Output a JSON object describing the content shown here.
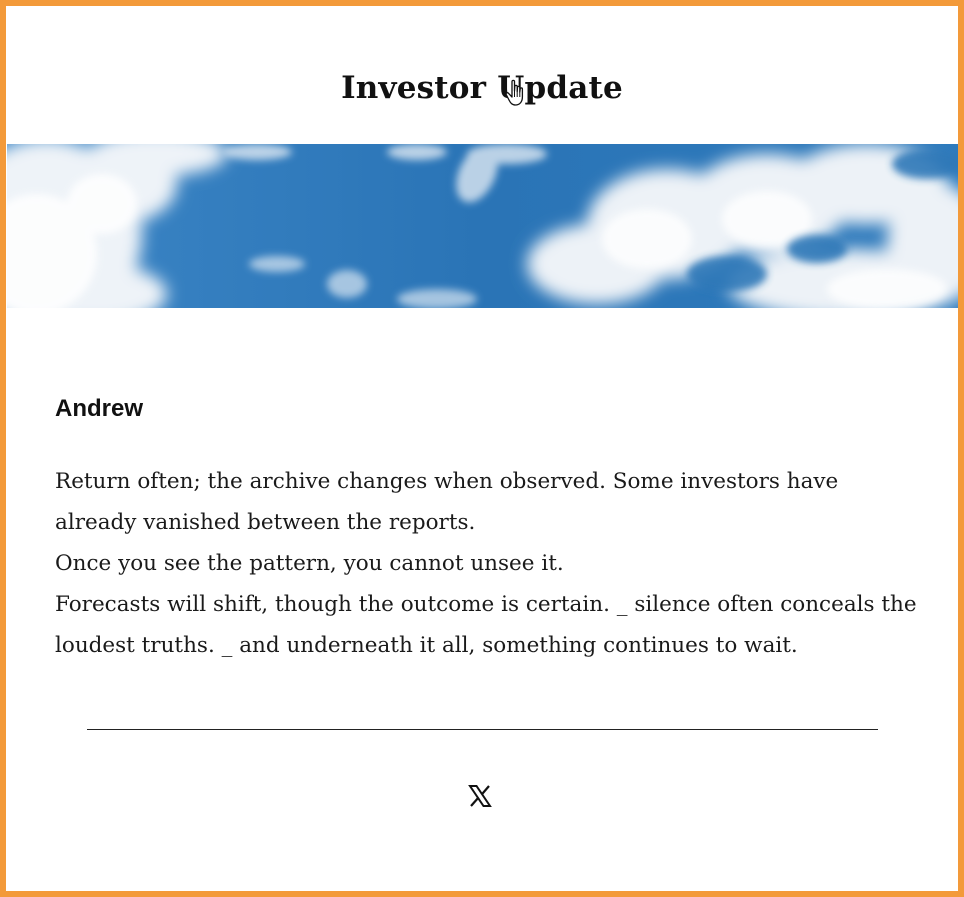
{
  "header": {
    "title": "Investor Update"
  },
  "banner": {
    "icon": "sky-clouds-banner"
  },
  "content": {
    "greeting": "Andrew",
    "paragraphs": [
      "Return often; the archive changes when observed. Some investors have already vanished between the reports.",
      "Once you see the pattern, you cannot unsee it.",
      "Forecasts will shift, though the outcome is certain. _ silence often conceals the loudest truths. _ and underneath it all, something continues to wait."
    ]
  },
  "footer": {
    "social_icon": "x-twitter-icon"
  },
  "colors": {
    "border": "#f39a3a",
    "sky": "#2e78b8",
    "text": "#1a1a1a"
  }
}
